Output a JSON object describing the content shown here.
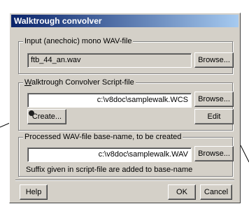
{
  "dialog": {
    "title": "Walktrough convolver",
    "input_group": {
      "legend": "Input (anechoic) mono WAV-file",
      "value": "ftb_44_an.wav",
      "browse_label": "Browse..."
    },
    "script_group": {
      "legend_first": "W",
      "legend_rest": "alktrough Convolver Script-file",
      "value": "c:\\v8doc\\samplewalk.WCS",
      "browse_label": "Browse...",
      "create_label": "Create...",
      "edit_label": "Edit"
    },
    "output_group": {
      "legend": "Processed WAV-file base-name, to be created",
      "value": "c:\\v8doc\\samplewalk.WAV",
      "browse_label": "Browse...",
      "note": "Suffix given in script-file are added to base-name"
    },
    "buttons": {
      "help": "Help",
      "ok": "OK",
      "cancel": "Cancel"
    }
  }
}
